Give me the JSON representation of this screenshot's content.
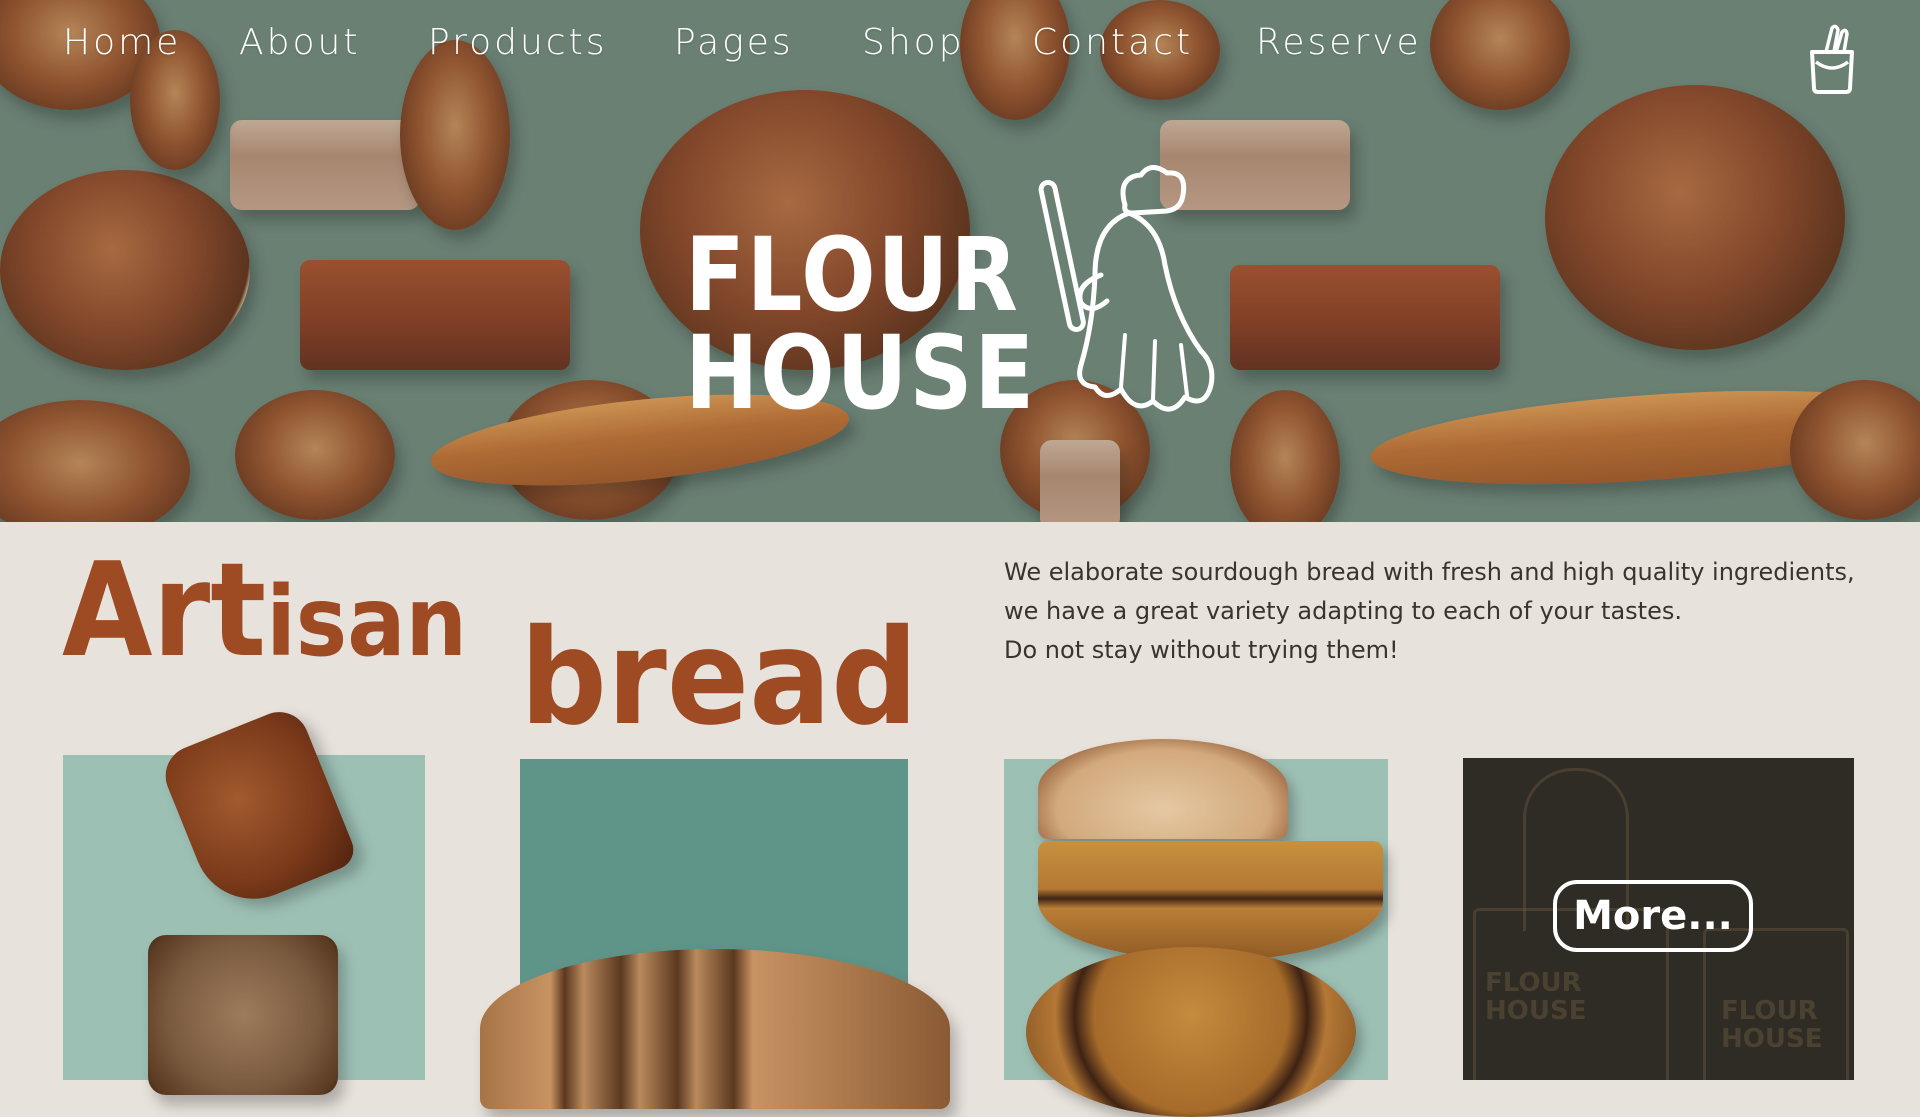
{
  "nav": {
    "items": [
      {
        "label": "Home"
      },
      {
        "label": "About"
      },
      {
        "label": "Products"
      },
      {
        "label": "Pages"
      },
      {
        "label": "Shop"
      },
      {
        "label": "Contact"
      },
      {
        "label": "Reserve"
      }
    ],
    "cart_icon": "shopping-bag-icon"
  },
  "hero": {
    "logo_line1": "FLOUR",
    "logo_line2": "HOUSE",
    "logo_icon": "baker-chef-icon"
  },
  "main": {
    "title_art": "Art",
    "title_isan": "isan",
    "title_bread": "bread",
    "description": [
      "We elaborate sourdough bread with fresh and high quality ingredients,",
      "we have a great variety adapting to each of your tastes.",
      "Do not stay without trying them!"
    ],
    "more_label": "More...",
    "bag_text_1": "FLOUR",
    "bag_text_2": "HOUSE"
  },
  "colors": {
    "hero_bg": "#6e8477",
    "page_bg": "#e7e2dc",
    "accent": "#9e4a22",
    "card_light": "#9dc0b5",
    "card_teal": "#5f9489",
    "card_dark": "#2f2c25"
  }
}
